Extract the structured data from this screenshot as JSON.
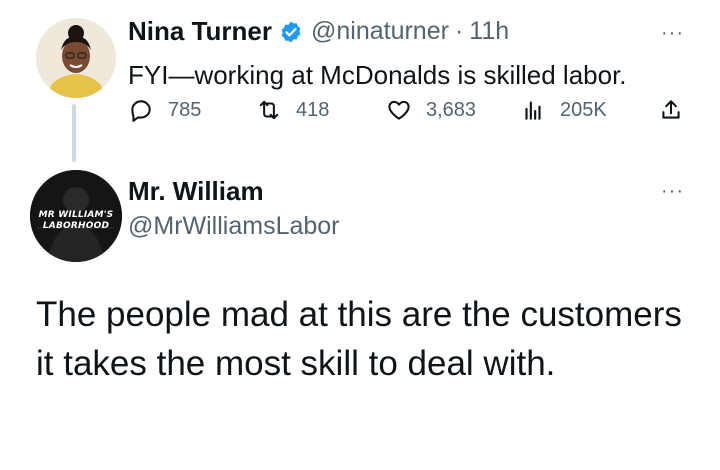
{
  "quoted_tweet": {
    "author_name": "Nina Turner",
    "handle": "@ninaturner",
    "separator": "·",
    "time": "11h",
    "text": "FYI—working at McDonalds is skilled labor.",
    "more_glyph": "···",
    "stats": {
      "replies": "785",
      "retweets": "418",
      "likes": "3,683",
      "views": "205K"
    }
  },
  "reply": {
    "author_name": "Mr. William",
    "handle": "@MrWilliamsLabor",
    "more_glyph": "···",
    "avatar_badge": [
      "MR WILLIAM'S",
      "LABORHOOD"
    ],
    "text": "The people mad at this are the customers it takes the most skill to deal with."
  },
  "colors": {
    "text": "#0f1419",
    "secondary": "#536471",
    "verified": "#1d9bf0",
    "thread_line": "#cfd9de"
  },
  "icons": [
    "verified-badge-icon",
    "reply-icon",
    "retweet-icon",
    "like-icon",
    "views-icon",
    "share-icon",
    "more-icon"
  ]
}
